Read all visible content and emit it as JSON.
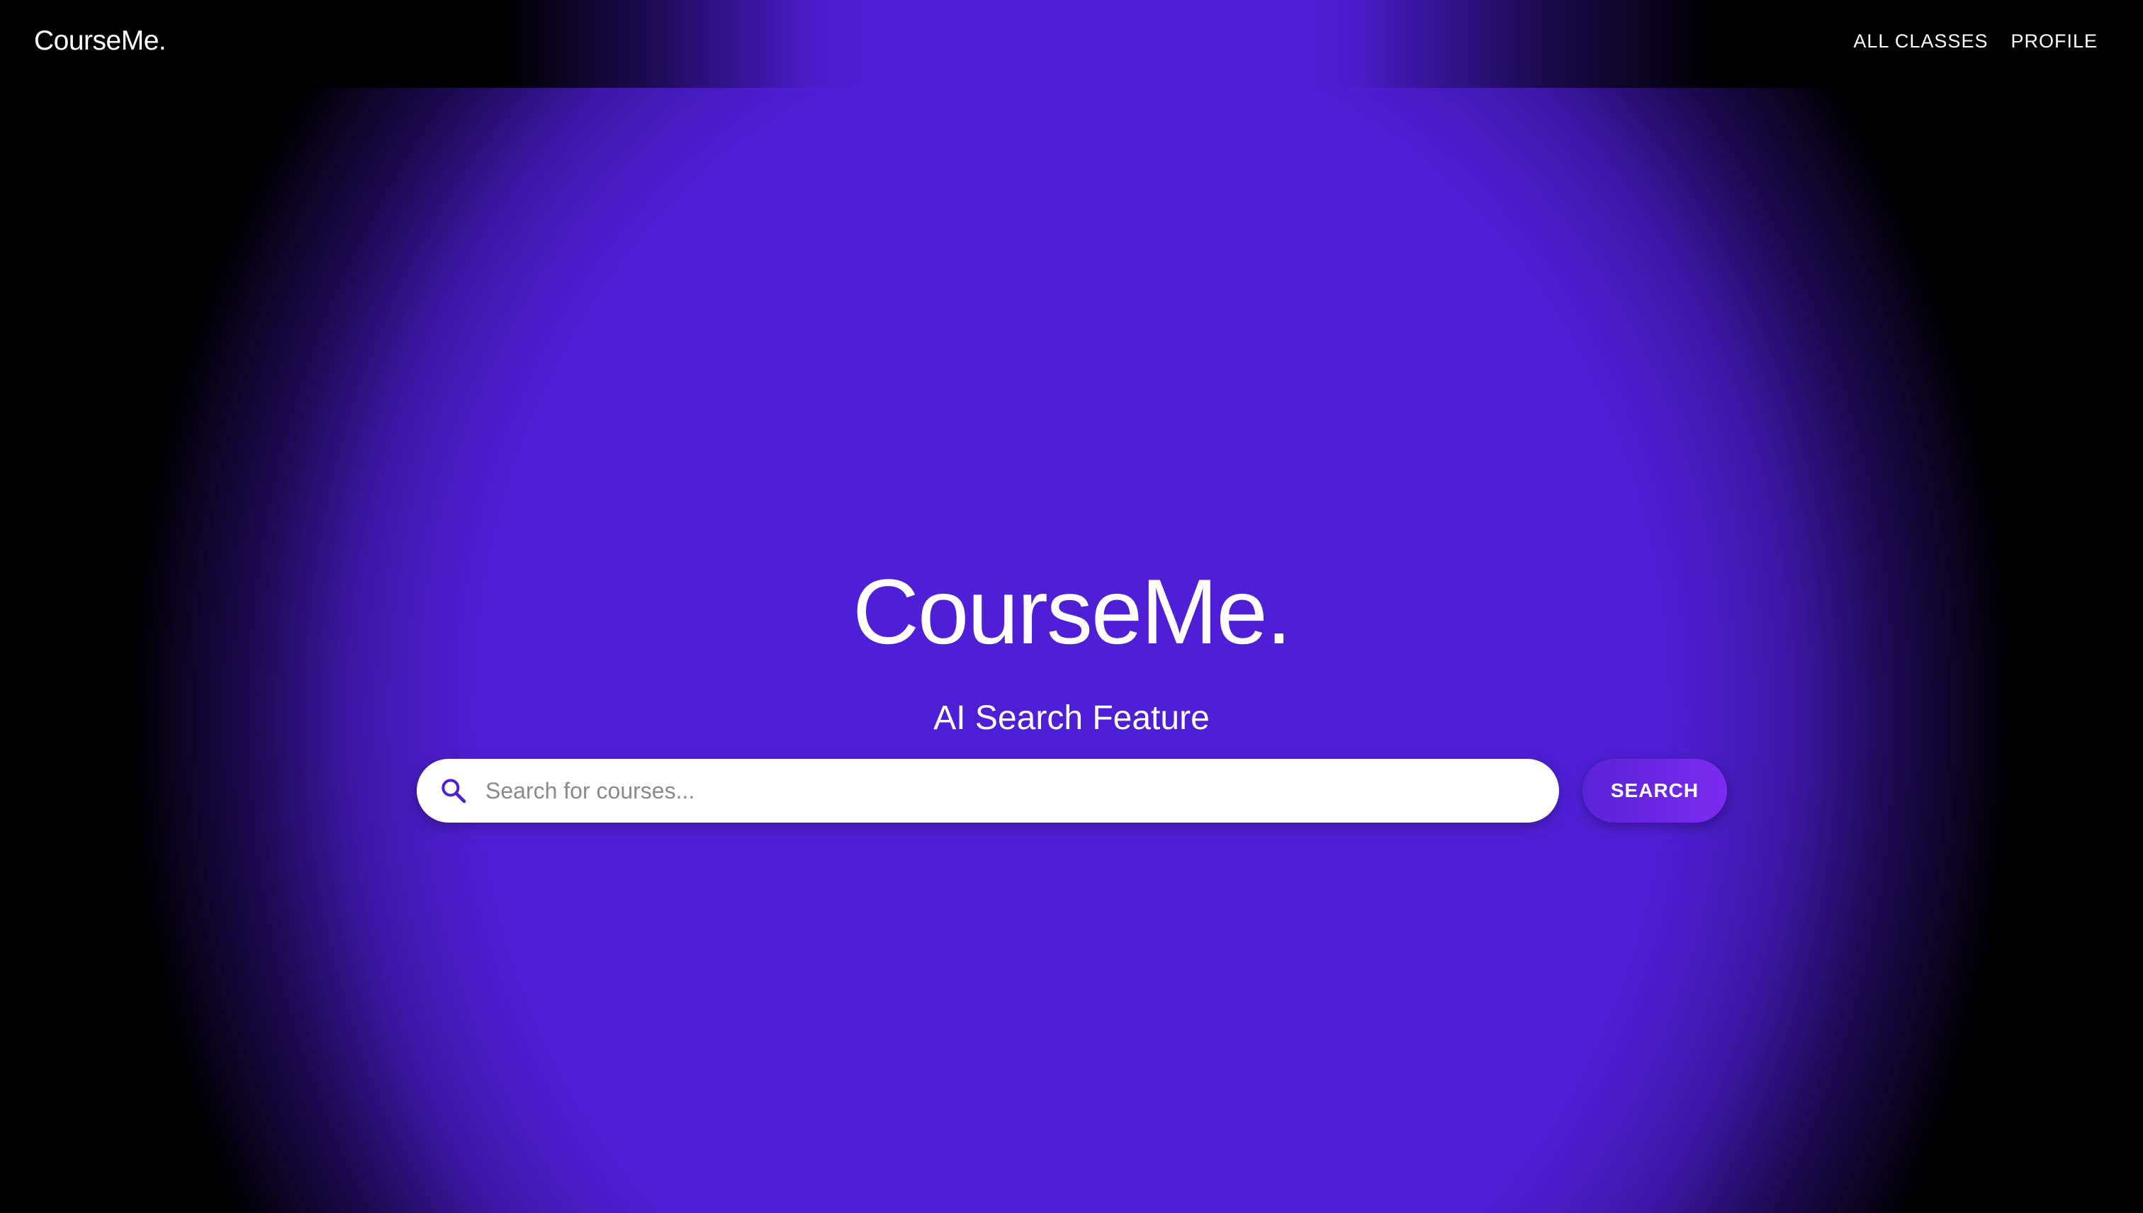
{
  "header": {
    "brand": "CourseMe.",
    "nav": [
      {
        "label": "ALL CLASSES"
      },
      {
        "label": "PROFILE"
      }
    ]
  },
  "hero": {
    "title": "CourseMe.",
    "subtitle": "AI Search Feature"
  },
  "search": {
    "icon": "search-icon",
    "placeholder": "Search for courses...",
    "value": "",
    "button_label": "SEARCH"
  },
  "colors": {
    "accent": "#4e1fd6",
    "button_start": "#5a22d8",
    "button_end": "#7b2bf0",
    "background": "#000000"
  }
}
